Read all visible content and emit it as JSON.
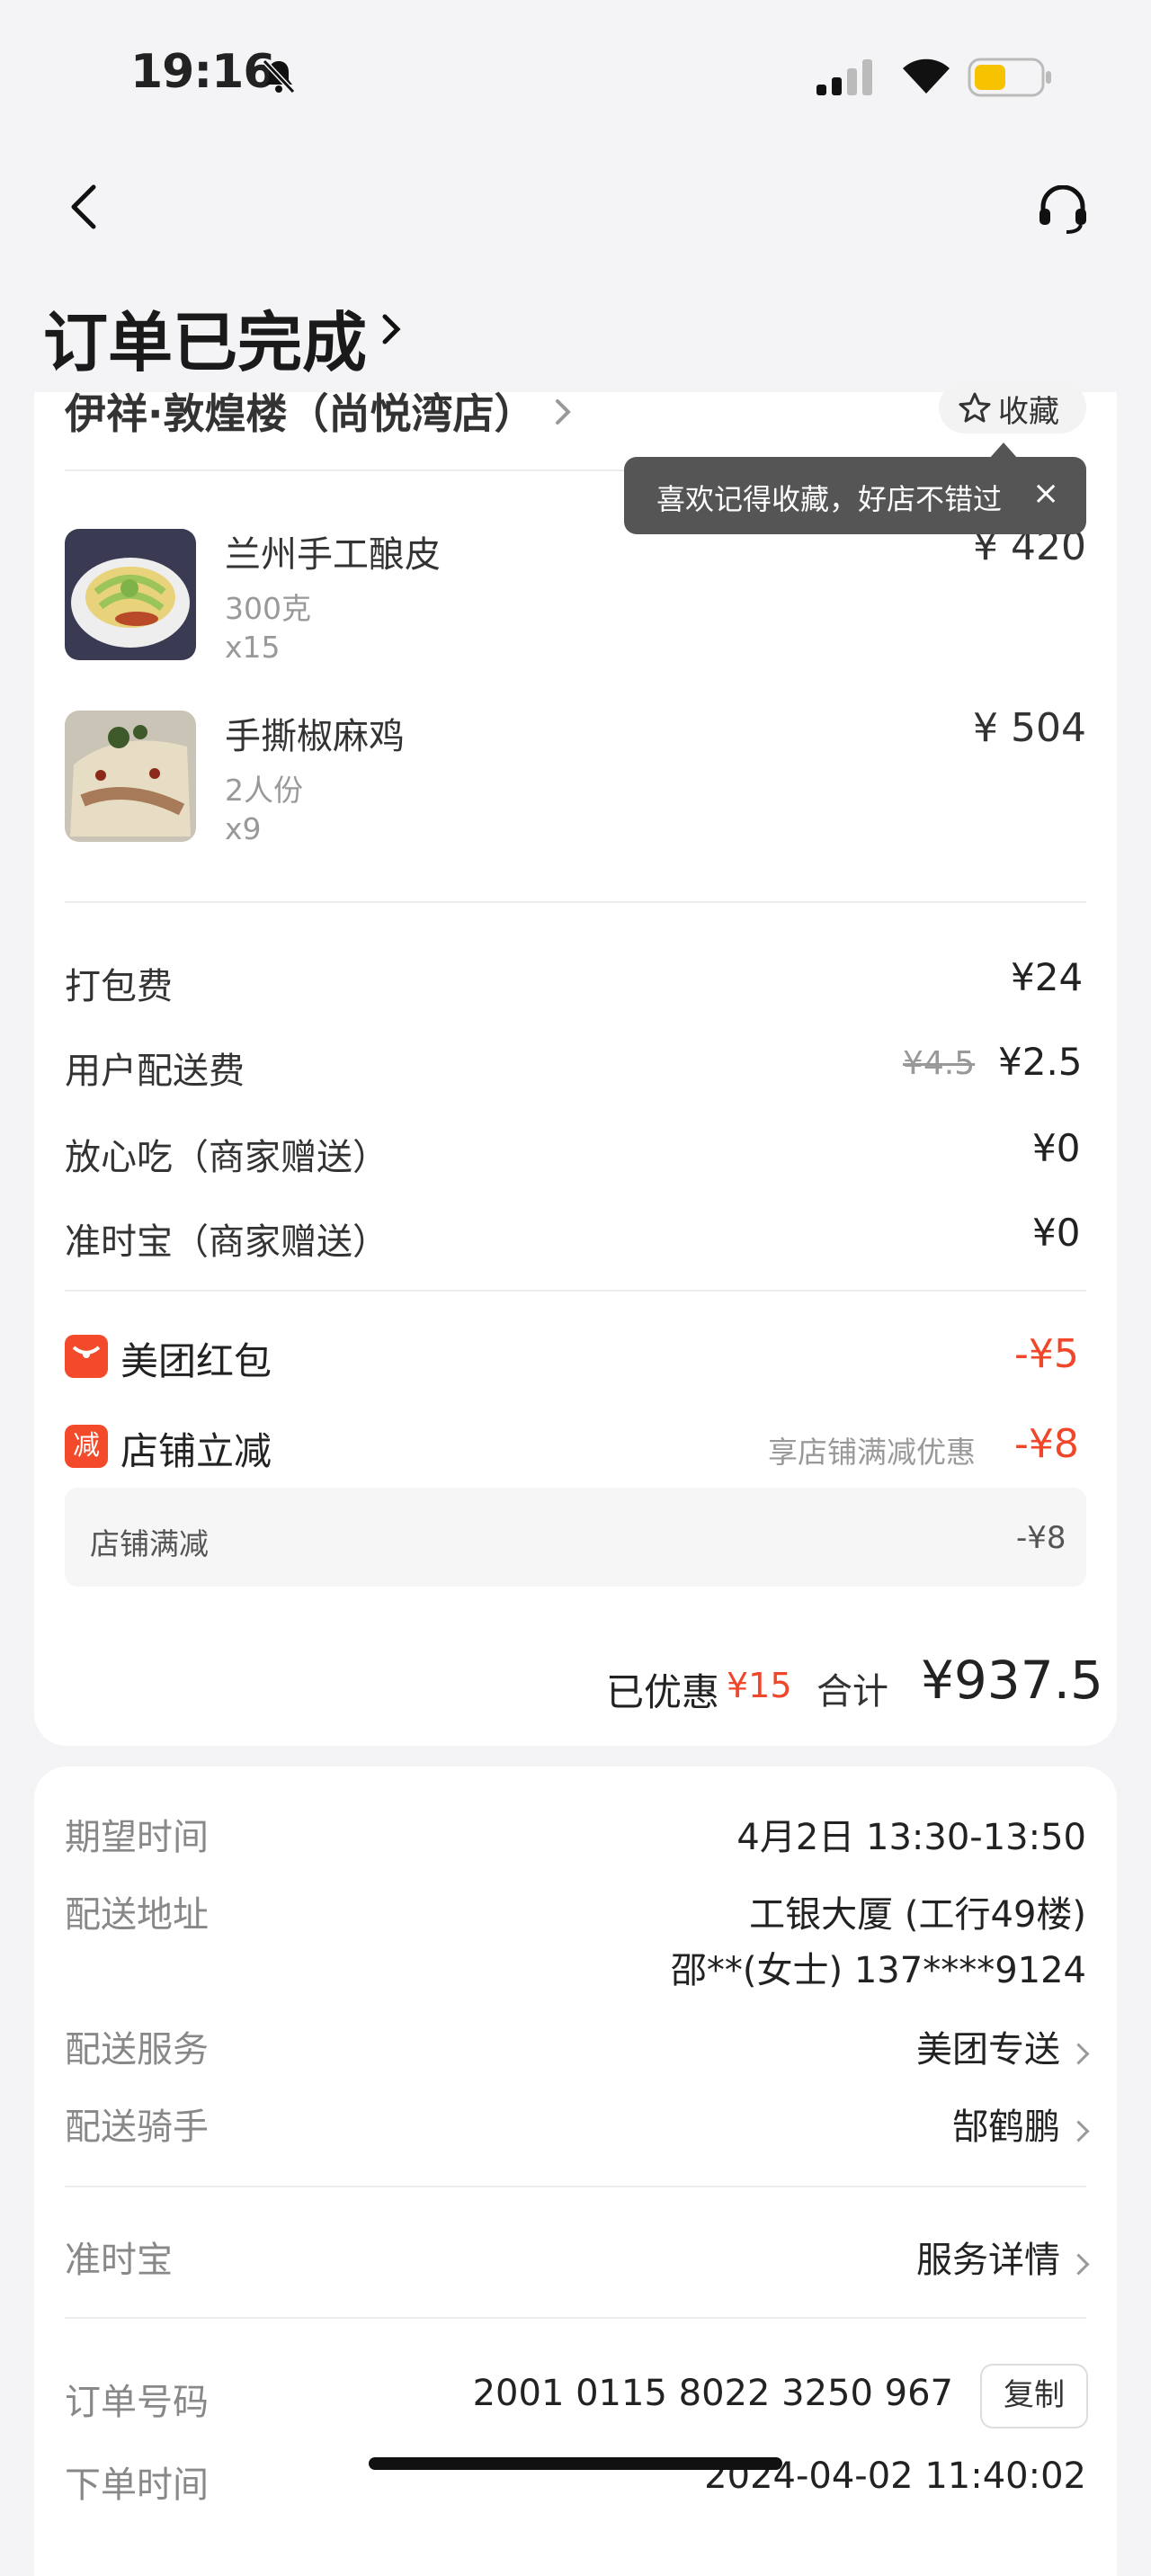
{
  "status_bar": {
    "time": "19:16"
  },
  "header": {
    "title": "订单已完成"
  },
  "store": {
    "name": "伊祥·敦煌楼（尚悦湾店）",
    "favorite_label": "收藏"
  },
  "tooltip": {
    "text": "喜欢记得收藏，好店不错过",
    "close": "×"
  },
  "items": [
    {
      "name": "兰州手工酿皮",
      "spec": "300克",
      "qty": "x15",
      "price": "¥ 420"
    },
    {
      "name": "手撕椒麻鸡",
      "spec": "2人份",
      "qty": "x9",
      "price": "¥ 504"
    }
  ],
  "fees": [
    {
      "label": "打包费",
      "value": "¥24"
    },
    {
      "label": "用户配送费",
      "original": "¥4.5",
      "value": "¥2.5"
    },
    {
      "label": "放心吃（商家赠送）",
      "value": "¥0"
    },
    {
      "label": "准时宝（商家赠送）",
      "value": "¥0"
    }
  ],
  "promos": [
    {
      "badge": "",
      "label": "美团红包",
      "value": "-¥5"
    },
    {
      "badge": "减",
      "label": "店铺立减",
      "note": "享店铺满减优惠",
      "value": "-¥8"
    }
  ],
  "promo_detail": {
    "label": "店铺满减",
    "value": "-¥8"
  },
  "summary": {
    "saved_label": "已优惠",
    "saved_value": "¥15",
    "total_label": "合计",
    "total_value": "¥937.5"
  },
  "delivery": {
    "expected_label": "期望时间",
    "expected_value": "4月2日 13:30-13:50",
    "address_label": "配送地址",
    "address_line1": "工银大厦 (工行49楼)",
    "address_line2": "邵**(女士) 137****9124",
    "service_label": "配送服务",
    "service_value": "美团专送",
    "rider_label": "配送骑手",
    "rider_value": "郜鹤鹏",
    "ontime_label": "准时宝",
    "ontime_value": "服务详情",
    "order_no_label": "订单号码",
    "order_no_value": "2001 0115 8022 3250 967",
    "copy_label": "复制",
    "order_time_label": "下单时间",
    "order_time_value": "2024-04-02 11:40:02"
  }
}
